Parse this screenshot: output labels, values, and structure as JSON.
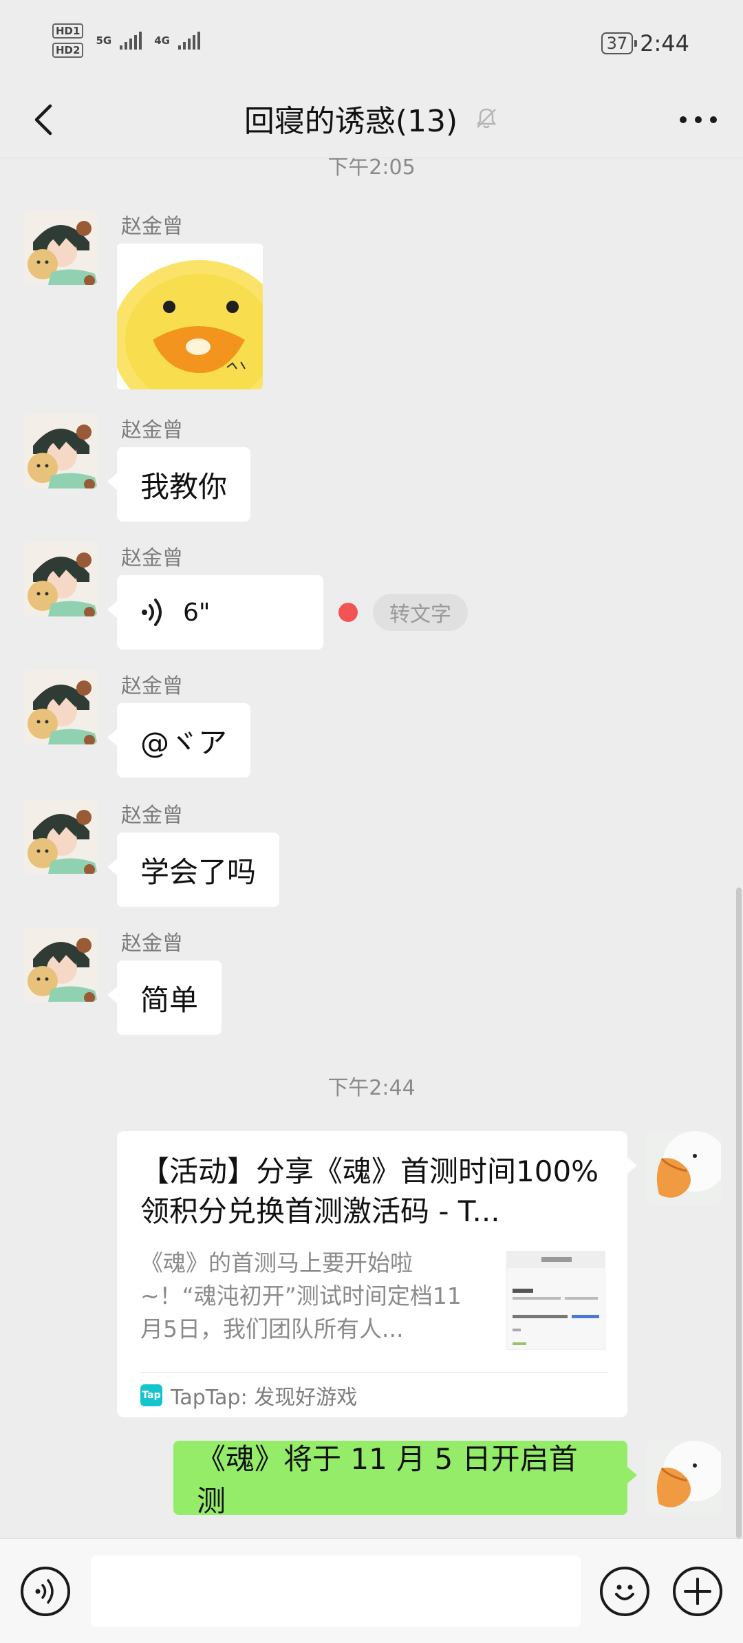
{
  "status_bar": {
    "hd1": "HD1",
    "hd2": "HD2",
    "sig1": "5G",
    "sig2": "4G",
    "battery": "37",
    "time": "2:44"
  },
  "header": {
    "title": "回寝的诱惑(13)",
    "icons": {
      "back": "back-arrow-icon",
      "mute": "muted-bell-icon",
      "more": "more-icon"
    }
  },
  "messages": {
    "timestamp_1": "下午2:05",
    "m1": {
      "sender": "赵金曾",
      "type": "sticker"
    },
    "m2": {
      "sender": "赵金曾",
      "text": "我教你"
    },
    "m3": {
      "sender": "赵金曾",
      "duration": "6\"",
      "to_text": "转文字"
    },
    "m4": {
      "sender": "赵金曾",
      "text": "@ヾア"
    },
    "m5": {
      "sender": "赵金曾",
      "text": "学会了吗"
    },
    "m6": {
      "sender": "赵金曾",
      "text": "简单"
    },
    "timestamp_2": "下午2:44",
    "link_card": {
      "title": "【活动】分享《魂》首测时间100%领积分兑换首测激活码 - T...",
      "description": "《魂》的首测马上要开始啦~！“魂沌初开”测试时间定档11月5日，我们团队所有人...",
      "source": "TapTap: 发现好游戏",
      "logo_text": "Tap"
    },
    "self_message": "《魂》将于 11 月 5 日开启首测"
  },
  "input_bar": {
    "placeholder": "",
    "icons": {
      "voice": "voice-mode-icon",
      "emoji": "emoji-icon",
      "plus": "plus-icon"
    }
  },
  "colors": {
    "background": "#ededed",
    "self_bubble": "#95ec69",
    "other_bubble": "#ffffff",
    "unread_dot": "#f25454",
    "taptap": "#15c5ce"
  }
}
